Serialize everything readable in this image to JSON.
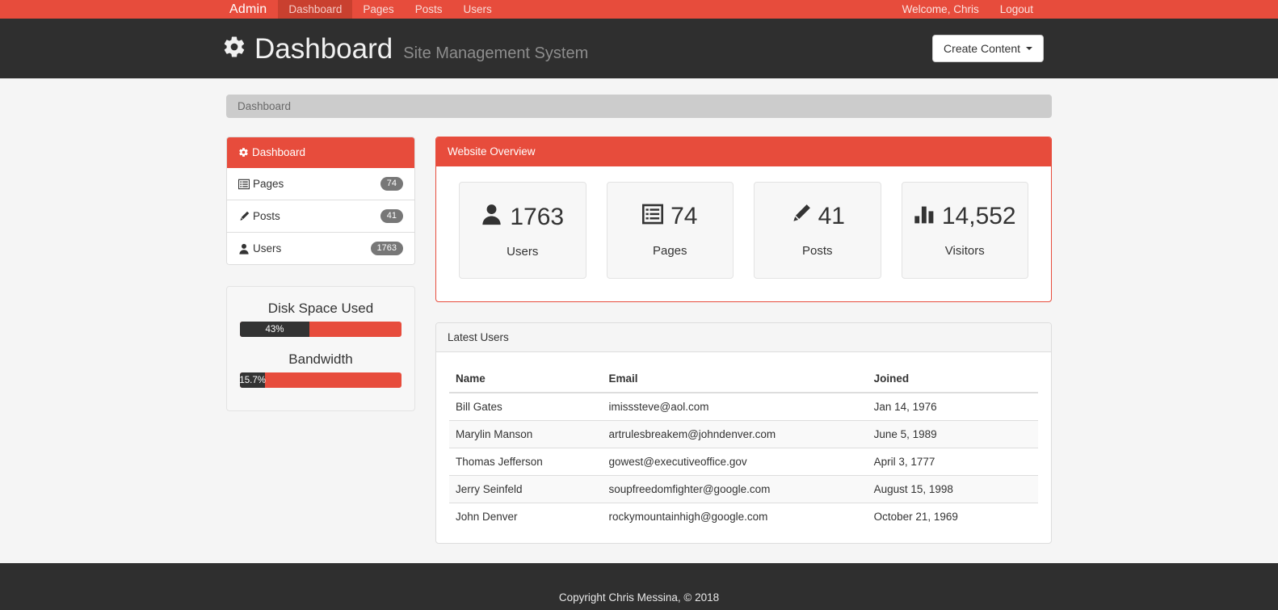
{
  "navbar": {
    "brand": "Admin",
    "items": [
      {
        "label": "Dashboard",
        "active": true
      },
      {
        "label": "Pages",
        "active": false
      },
      {
        "label": "Posts",
        "active": false
      },
      {
        "label": "Users",
        "active": false
      }
    ],
    "welcome": "Welcome, Chris",
    "logout": "Logout"
  },
  "header": {
    "icon": "gear-icon",
    "title": "Dashboard",
    "subtitle": "Site Management System",
    "create_button": "Create Content"
  },
  "breadcrumb": {
    "current": "Dashboard"
  },
  "sidebar": {
    "items": [
      {
        "label": "Dashboard",
        "icon": "gear-icon",
        "badge": "",
        "active": true
      },
      {
        "label": "Pages",
        "icon": "list-alt-icon",
        "badge": "74",
        "active": false
      },
      {
        "label": "Posts",
        "icon": "pencil-icon",
        "badge": "41",
        "active": false
      },
      {
        "label": "Users",
        "icon": "user-icon",
        "badge": "1763",
        "active": false
      }
    ],
    "meters": [
      {
        "title": "Disk Space Used",
        "value": "43%",
        "percent": 43
      },
      {
        "title": "Bandwidth",
        "value": "15.7%",
        "percent": 15.7
      }
    ]
  },
  "overview": {
    "heading": "Website Overview",
    "stats": [
      {
        "icon": "user-icon",
        "value": "1763",
        "label": "Users"
      },
      {
        "icon": "list-alt-icon",
        "value": "74",
        "label": "Pages"
      },
      {
        "icon": "pencil-icon",
        "value": "41",
        "label": "Posts"
      },
      {
        "icon": "bar-chart-icon",
        "value": "14,552",
        "label": "Visitors"
      }
    ]
  },
  "latest_users": {
    "heading": "Latest Users",
    "columns": [
      "Name",
      "Email",
      "Joined"
    ],
    "rows": [
      {
        "name": "Bill Gates",
        "email": "imisssteve@aol.com",
        "joined": "Jan 14, 1976"
      },
      {
        "name": "Marylin Manson",
        "email": "artrulesbreakem@johndenver.com",
        "joined": "June 5, 1989"
      },
      {
        "name": "Thomas Jefferson",
        "email": "gowest@executiveoffice.gov",
        "joined": "April 3, 1777"
      },
      {
        "name": "Jerry Seinfeld",
        "email": "soupfreedomfighter@google.com",
        "joined": "August 15, 1998"
      },
      {
        "name": "John Denver",
        "email": "rockymountainhigh@google.com",
        "joined": "October 21, 1969"
      }
    ]
  },
  "footer": {
    "copyright": "Copyright Chris Messina, © 2018"
  },
  "colors": {
    "accent": "#e74c3c",
    "accent_dark": "#c9402f",
    "header_dark": "#2f2f2f",
    "page_bg": "#f5f5f5",
    "badge": "#777777",
    "progress_fill": "#333333"
  }
}
